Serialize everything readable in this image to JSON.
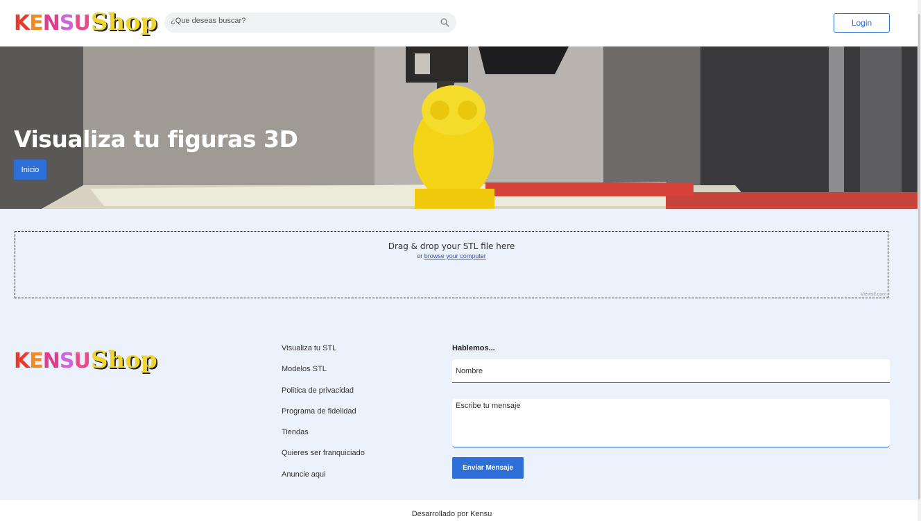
{
  "header": {
    "logo_letters": [
      "K",
      "E",
      "N",
      "S",
      "U"
    ],
    "logo_colors": [
      "#e8392f",
      "#f28b1d",
      "#e23c8c",
      "#cc66d9",
      "#e84d8a"
    ],
    "logo_shop": "Shop",
    "search_placeholder": "¿Que deseas buscar?",
    "login_label": "Login"
  },
  "hero": {
    "title": "Visualiza tu figuras 3D",
    "button_label": "Inicio"
  },
  "dropzone": {
    "main_text": "Drag & drop your STL file here",
    "sub_prefix": "or",
    "browse_link": "browse your computer",
    "brand": "Viewstl.com"
  },
  "footer": {
    "links": [
      "Visualiza tu STL",
      "Modelos STL",
      "Politica de privacidad",
      "Programa de fidelidad",
      "Tiendas",
      "Quieres ser franquiciado",
      "Anuncie aqui"
    ],
    "form_title": "Hablemos...",
    "name_placeholder": "Nombre",
    "message_placeholder": "Escribe tu mensaje",
    "send_label": "Enviar Mensaje",
    "credit": "Desarrollado por Kensu"
  },
  "colors": {
    "accent": "#2d6fd6",
    "page_bg": "#ecf2fb"
  }
}
